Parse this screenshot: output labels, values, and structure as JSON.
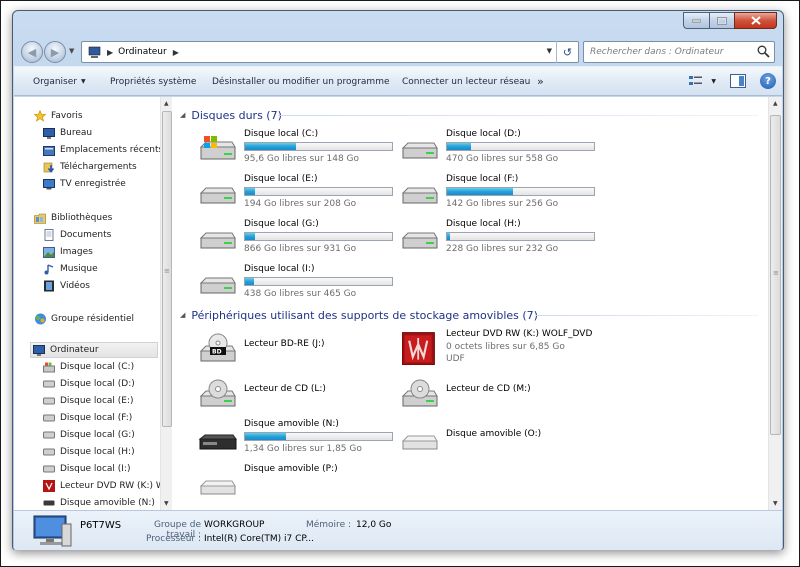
{
  "address": {
    "crumb": "Ordinateur",
    "search_placeholder": "Rechercher dans : Ordinateur"
  },
  "toolbar": {
    "organize": "Organiser",
    "system_properties": "Propriétés système",
    "uninstall": "Désinstaller ou modifier un programme",
    "map_drive": "Connecter un lecteur réseau",
    "more": "»"
  },
  "nav": {
    "favorites": "Favoris",
    "desktop": "Bureau",
    "recent": "Emplacements récents",
    "downloads": "Téléchargements",
    "tv": "TV enregistrée",
    "libraries": "Bibliothèques",
    "documents": "Documents",
    "pictures": "Images",
    "music": "Musique",
    "videos": "Vidéos",
    "homegroup": "Groupe résidentiel",
    "computer": "Ordinateur",
    "drives": [
      "Disque local (C:)",
      "Disque local (D:)",
      "Disque local (E:)",
      "Disque local (F:)",
      "Disque local (G:)",
      "Disque local (H:)",
      "Disque local (I:)",
      "Lecteur DVD RW (K:) WO",
      "Disque amovible (N:)"
    ]
  },
  "groups": {
    "hdd": "Disques durs (7)",
    "removable": "Périphériques utilisant des supports de stockage amovibles (7)"
  },
  "hard_drives": [
    {
      "name": "Disque local (C:)",
      "free": "95,6 Go libres sur 148 Go",
      "used_fraction": 0.35
    },
    {
      "name": "Disque local (D:)",
      "free": "470 Go libres sur 558 Go",
      "used_fraction": 0.16
    },
    {
      "name": "Disque local (E:)",
      "free": "194 Go libres sur 208 Go",
      "used_fraction": 0.07
    },
    {
      "name": "Disque local (F:)",
      "free": "142 Go libres sur 256 Go",
      "used_fraction": 0.45
    },
    {
      "name": "Disque local (G:)",
      "free": "866 Go libres sur 931 Go",
      "used_fraction": 0.07
    },
    {
      "name": "Disque local (H:)",
      "free": "228 Go libres sur 232 Go",
      "used_fraction": 0.02
    },
    {
      "name": "Disque local (I:)",
      "free": "438 Go libres sur 465 Go",
      "used_fraction": 0.06
    }
  ],
  "removable": {
    "bd": "Lecteur BD-RE (J:)",
    "dvd_name": "Lecteur DVD RW (K:) WOLF_DVD",
    "dvd_free": "0 octets libres sur 6,85 Go",
    "dvd_fs": "UDF",
    "cd_l": "Lecteur de CD (L:)",
    "cd_m": "Lecteur de CD (M:)",
    "n_name": "Disque amovible (N:)",
    "n_free": "1,34 Go libres sur 1,85 Go",
    "n_used_fraction": 0.28,
    "o_name": "Disque amovible (O:)",
    "p_name": "Disque amovible (P:)"
  },
  "details": {
    "pc_name": "P6T7WS",
    "workgroup_label": "Groupe de travail :",
    "workgroup_value": "WORKGROUP",
    "memory_label": "Mémoire :",
    "memory_value": "12,0 Go",
    "cpu_label": "Processeur :",
    "cpu_value": "Intel(R) Core(TM) i7 CP..."
  },
  "colors": {
    "accent": "#1e3287",
    "bar": "#26a0da",
    "close": "#c2351d"
  }
}
